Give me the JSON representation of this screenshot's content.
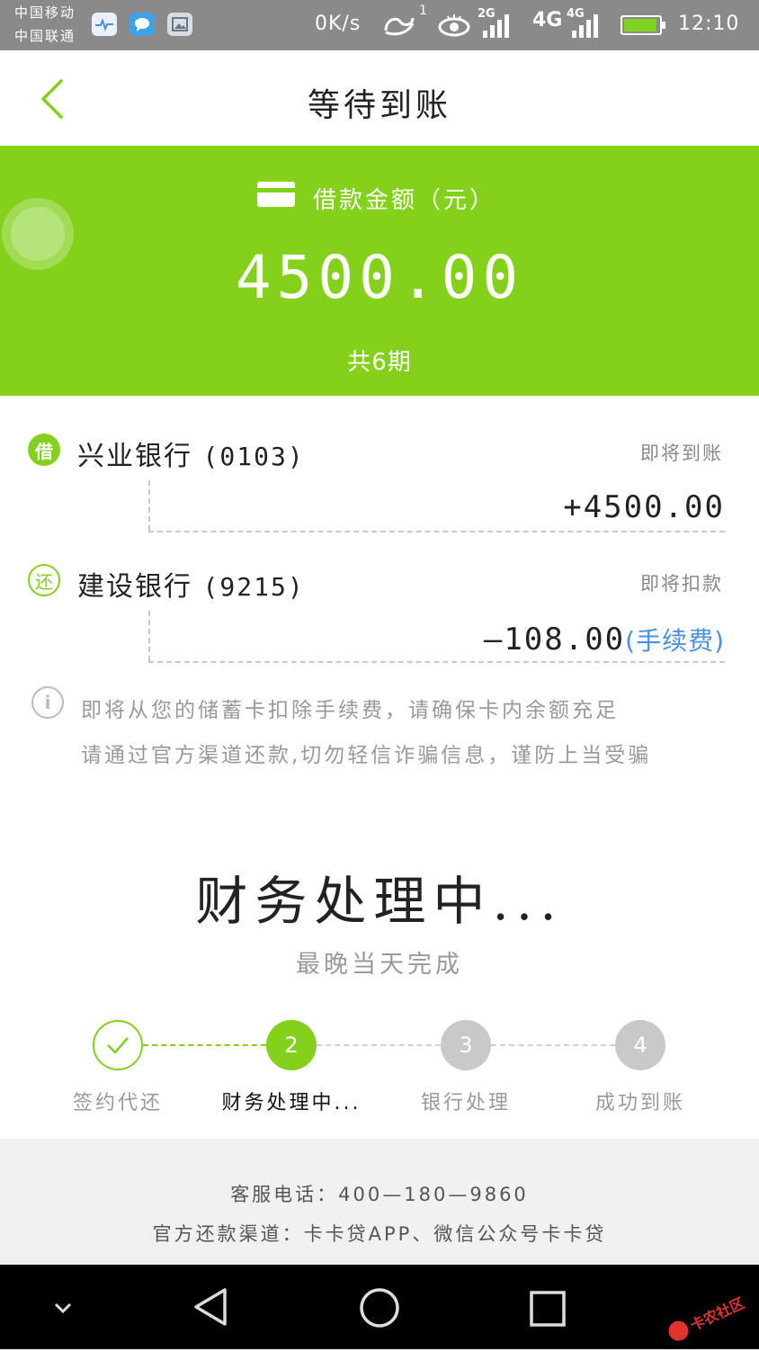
{
  "status_bar": {
    "carrier_1": "中国移动",
    "carrier_2": "中国联通",
    "speed": "0K/s",
    "hd_superscript": "1",
    "sim1_tag": "2G",
    "sim2_network": "4G",
    "sim2_tag": "4G",
    "time": "12:10",
    "icons": [
      "health-app-icon",
      "message-app-icon",
      "gallery-app-icon",
      "hd-icon",
      "eye-icon",
      "signal-icon",
      "battery-charging-icon"
    ]
  },
  "header": {
    "title": "等待到账",
    "back_icon": "chevron-left-icon"
  },
  "banner": {
    "label": "借款金额（元）",
    "amount": "4500.00",
    "periods": "共6期",
    "card_icon": "credit-card-icon"
  },
  "accounts": [
    {
      "badge": "借",
      "bank": "兴业银行",
      "tail": "(0103)",
      "status": "即将到账",
      "amount": "+4500.00"
    },
    {
      "badge": "还",
      "bank": "建设银行",
      "tail": "(9215)",
      "status": "即将扣款",
      "amount": "—108.00",
      "fee_link": "(手续费)"
    }
  ],
  "notice": {
    "line1": "即将从您的储蓄卡扣除手续费，请确保卡内余额充足",
    "line2": "请通过官方渠道还款,切勿轻信诈骗信息，谨防上当受骗"
  },
  "processing": {
    "title": "财务处理中...",
    "subtitle": "最晚当天完成"
  },
  "steps": [
    {
      "label": "签约代还",
      "state": "done",
      "number": "✓"
    },
    {
      "label": "财务处理中...",
      "state": "active",
      "number": "2"
    },
    {
      "label": "银行处理",
      "state": "pending",
      "number": "3"
    },
    {
      "label": "成功到账",
      "state": "pending",
      "number": "4"
    }
  ],
  "footer": {
    "hotline": "客服电话：400—180—9860",
    "channels": "官方还款渠道：卡卡贷APP、微信公众号卡卡贷"
  },
  "watermark": "卡农社区",
  "colors": {
    "accent": "#83d11b",
    "link": "#4a90e2",
    "status_bar": "#8a8a8a"
  }
}
